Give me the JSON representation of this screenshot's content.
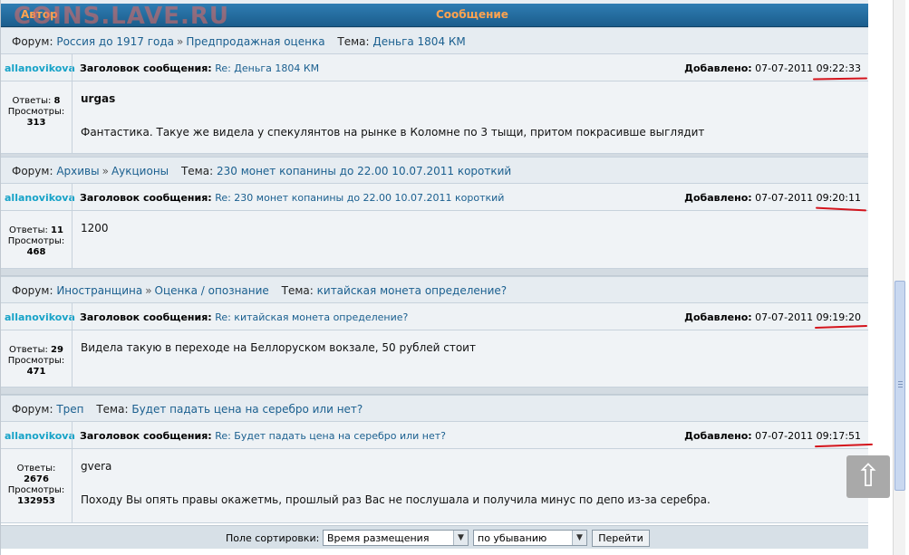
{
  "watermark": "COINS.LAVE.RU",
  "header": {
    "author_col": "Автор",
    "message_col": "Сообщение"
  },
  "labels": {
    "forum": "Форум:",
    "topic": "Тема:",
    "subject": "Заголовок сообщения:",
    "added": "Добавлено:",
    "replies": "Ответы:",
    "views": "Просмотры:",
    "breadcrumb_sep": "»"
  },
  "posts": [
    {
      "forum_path": [
        "Россия до 1917 года",
        "Предпродажная оценка"
      ],
      "topic": "Деньга 1804 КМ",
      "author": "allanovikova",
      "subject": "Re: Деньга 1804 КМ",
      "date": "07-07-2011",
      "time": "09:22:33",
      "replies": "8",
      "views": "313",
      "quote_author": "urgas",
      "text": "Фантастика. Такуе же видела у спекулянтов на рынке в Коломне по 3 тыщи, притом покрасивше выглядит"
    },
    {
      "forum_path": [
        "Архивы",
        "Аукционы"
      ],
      "topic": "230 монет копанины до 22.00 10.07.2011 короткий",
      "author": "allanovikova",
      "subject": "Re: 230 монет копанины до 22.00 10.07.2011 короткий",
      "date": "07-07-2011",
      "time": "09:20:11",
      "replies": "11",
      "views": "468",
      "quote_author": "",
      "text": "1200"
    },
    {
      "forum_path": [
        "Иностранщина",
        "Оценка / опознание"
      ],
      "topic": "китайская монета определение?",
      "author": "allanovikova",
      "subject": "Re: китайская монета определение?",
      "date": "07-07-2011",
      "time": "09:19:20",
      "replies": "29",
      "views": "471",
      "quote_author": "",
      "text": "Видела такую в переходе на Беллоруском вокзале, 50 рублей стоит"
    },
    {
      "forum_path": [
        "Треп"
      ],
      "topic": "Будет падать цена на серебро или нет?",
      "author": "allanovikova",
      "subject": "Re: Будет падать цена на серебро или нет?",
      "date": "07-07-2011",
      "time": "09:17:51",
      "replies": "2676",
      "views": "132953",
      "quote_author": "gvera",
      "text": "Походу Вы опять правы окажетмь, прошлый раз Вас не послушала и получила минус по депо из-за серебра."
    }
  ],
  "footer": {
    "sort_label": "Поле сортировки:",
    "sort_field": "Время размещения",
    "sort_order": "по убыванию",
    "go_button": "Перейти"
  },
  "colors": {
    "accent_red": "#d4141c",
    "author": "#17a3c8",
    "link": "#1a5f8f",
    "header_text": "#ffa34f"
  }
}
